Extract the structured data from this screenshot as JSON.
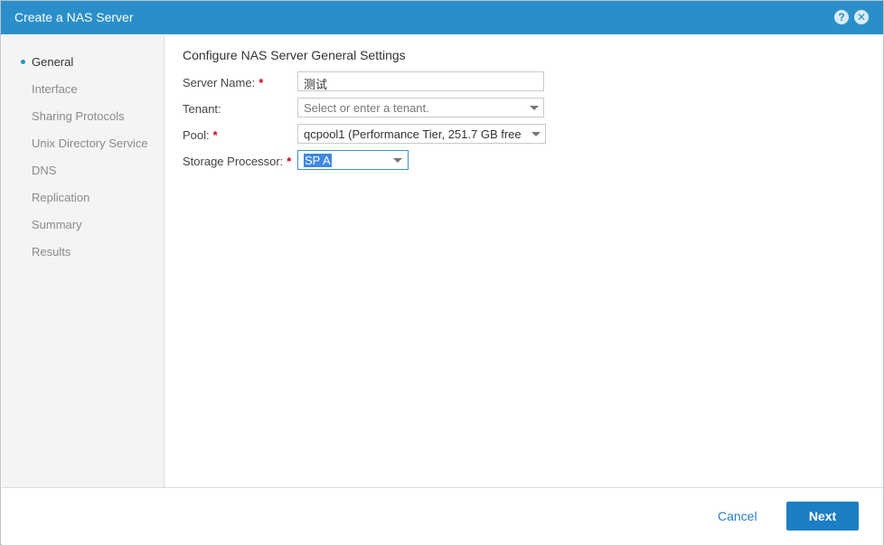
{
  "dialog": {
    "title": "Create a NAS Server",
    "help_icon_glyph": "?",
    "close_icon_glyph": "✕"
  },
  "sidebar": {
    "items": [
      {
        "label": "General",
        "active": true
      },
      {
        "label": "Interface"
      },
      {
        "label": "Sharing Protocols"
      },
      {
        "label": "Unix Directory Service"
      },
      {
        "label": "DNS"
      },
      {
        "label": "Replication"
      },
      {
        "label": "Summary"
      },
      {
        "label": "Results"
      }
    ]
  },
  "form": {
    "section_title": "Configure NAS Server General Settings",
    "required_marker": "*",
    "server_name": {
      "label": "Server Name:",
      "value": "测试"
    },
    "tenant": {
      "label": "Tenant:",
      "placeholder": "Select or enter a tenant."
    },
    "pool": {
      "label": "Pool:",
      "value": "qcpool1 (Performance Tier, 251.7 GB free"
    },
    "storage_processor": {
      "label": "Storage Processor:",
      "value": "SP A"
    }
  },
  "footer": {
    "cancel_label": "Cancel",
    "next_label": "Next"
  },
  "colors": {
    "titlebar": "#2a8fc8",
    "primary_button": "#1c7ec4",
    "required": "#d0021b"
  }
}
